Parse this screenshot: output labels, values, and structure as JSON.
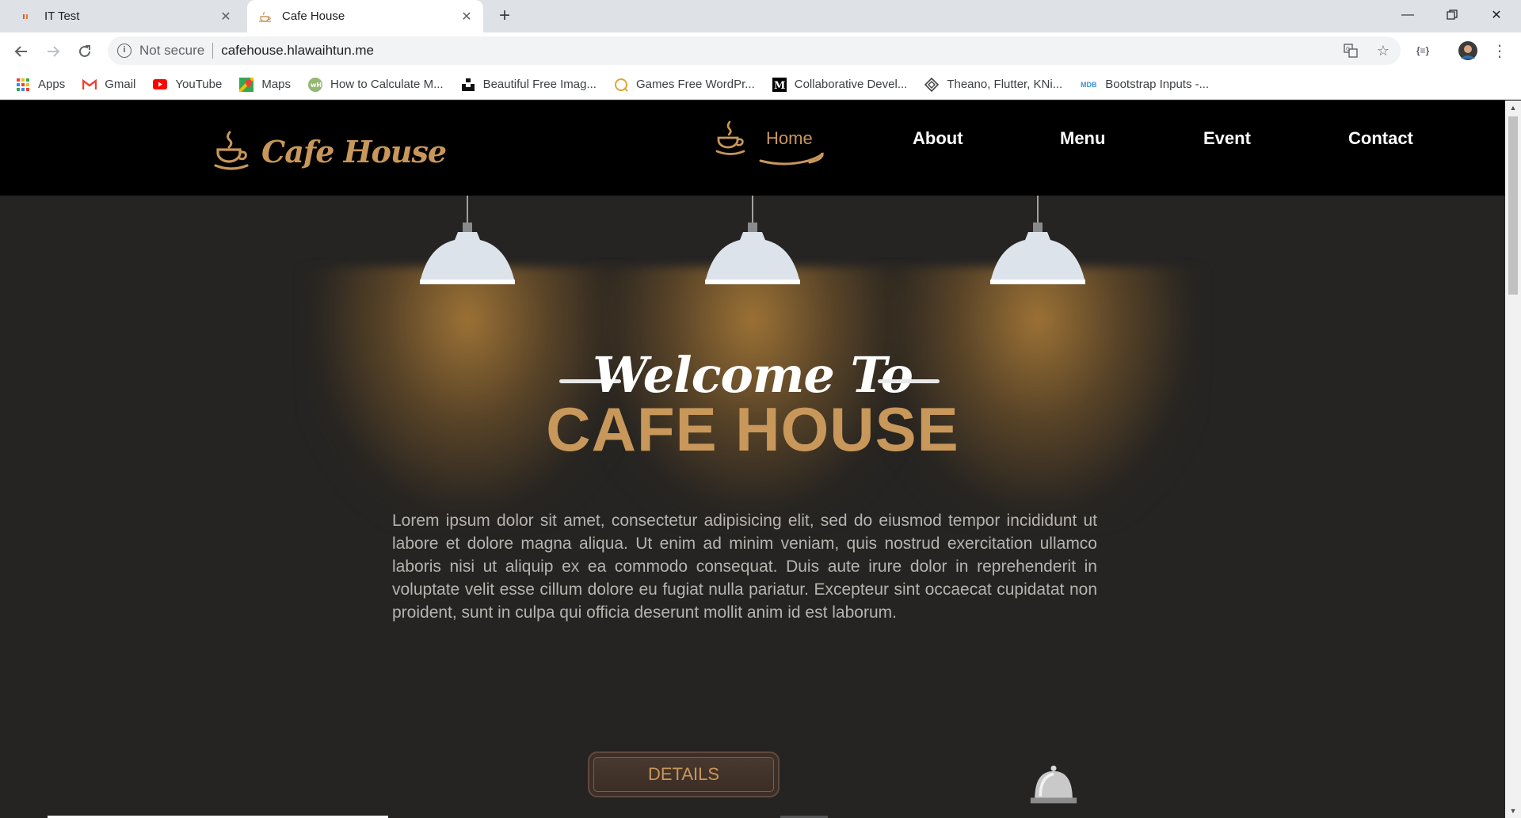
{
  "browser": {
    "tabs": [
      {
        "title": "IT Test",
        "active": false,
        "icon": "it-test-favicon"
      },
      {
        "title": "Cafe House",
        "active": true,
        "icon": "coffee-cup-favicon"
      }
    ],
    "address": {
      "security_label": "Not secure",
      "url": "cafehouse.hlawaihtun.me"
    },
    "bookmarks": [
      {
        "label": "Apps",
        "icon": "apps-grid-icon"
      },
      {
        "label": "Gmail",
        "icon": "gmail-icon"
      },
      {
        "label": "YouTube",
        "icon": "youtube-icon"
      },
      {
        "label": "Maps",
        "icon": "maps-icon"
      },
      {
        "label": "How to Calculate M...",
        "icon": "wikihow-icon"
      },
      {
        "label": "Beautiful Free Imag...",
        "icon": "unsplash-icon"
      },
      {
        "label": "Games Free WordPr...",
        "icon": "wordpress-icon"
      },
      {
        "label": "Collaborative Devel...",
        "icon": "medium-icon"
      },
      {
        "label": "Theano, Flutter, KNi...",
        "icon": "diamond-icon"
      },
      {
        "label": "Bootstrap Inputs -...",
        "icon": "mdb-icon"
      }
    ]
  },
  "site": {
    "logo_text": "Cafe House",
    "nav": [
      {
        "label": "Home",
        "active": true
      },
      {
        "label": "About",
        "active": false
      },
      {
        "label": "Menu",
        "active": false
      },
      {
        "label": "Event",
        "active": false
      },
      {
        "label": "Contact",
        "active": false
      }
    ],
    "hero": {
      "welcome": "Welcome To",
      "title": "CAFE  HOUSE",
      "body": "Lorem ipsum dolor sit amet, consectetur adipisicing elit, sed do eiusmod tempor incididunt ut labore et dolore magna aliqua. Ut enim ad minim veniam, quis nostrud exercitation ullamco laboris nisi ut aliquip ex ea commodo consequat. Duis aute irure dolor in reprehenderit in voluptate velit esse cillum dolore eu fugiat nulla pariatur. Excepteur sint occaecat cupidatat non proident, sunt in culpa qui officia deserunt mollit anim id est laborum.",
      "button": "DETAILS"
    }
  },
  "colors": {
    "accent": "#c8975a",
    "nav_bg": "#000000",
    "page_bg": "#252423"
  }
}
